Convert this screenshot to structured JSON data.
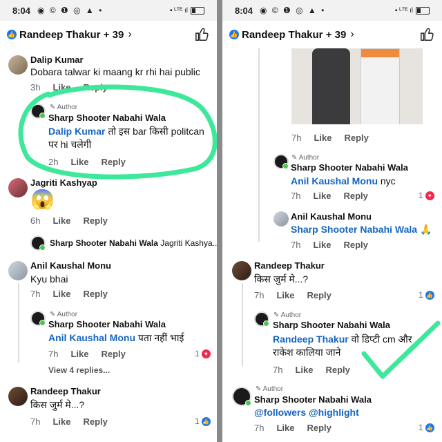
{
  "status": {
    "time": "8:04",
    "icons": "◉ © ❶ ◎ ▲ •",
    "net": "▪ ᴸᵀᴱ ıl"
  },
  "header": {
    "title": "Randeep Thakur + 39",
    "like_glyph": "👍"
  },
  "left": {
    "c1": {
      "name": "Dalip Kumar",
      "text": "Dobara talwar ki maang kr rhi hai public",
      "time": "3h",
      "like": "Like",
      "reply": "Reply"
    },
    "r1": {
      "author_label": "Author",
      "name": "Sharp Shooter Nabahi Wala",
      "mention": "Dalip Kumar",
      "text1": "तो इस bar किसी politcan",
      "text2": "पर hi चलेगी",
      "time": "2h",
      "like": "Like",
      "reply": "Reply"
    },
    "c2": {
      "name": "Jagriti Kashyap",
      "emoji": "😱",
      "time": "6h",
      "like": "Like",
      "reply": "Reply"
    },
    "c2_reply": {
      "name": "Sharp Shooter Nabahi Wala",
      "preview": "Jagriti Kashya..."
    },
    "c3": {
      "name": "Anil Kaushal Monu",
      "text": "Kyu bhai",
      "time": "7h",
      "like": "Like",
      "reply": "Reply"
    },
    "r3": {
      "author_label": "Author",
      "name": "Sharp Shooter Nabahi Wala",
      "mention": "Anil Kaushal Monu",
      "text": "पता नहीं भाई",
      "time": "7h",
      "like": "Like",
      "reply": "Reply",
      "reactions": "1"
    },
    "view_replies": "View 4 replies...",
    "c4": {
      "name": "Randeep Thakur",
      "text": "किस जुर्म मे...?",
      "time": "7h",
      "like": "Like",
      "reply": "Reply",
      "reactions": "1"
    }
  },
  "right": {
    "photo_meta": {
      "time": "7h",
      "like": "Like",
      "reply": "Reply"
    },
    "r1": {
      "author_label": "Author",
      "name": "Sharp Shooter Nabahi Wala",
      "mention": "Anil Kaushal Monu",
      "text": "nyc",
      "time": "7h",
      "like": "Like",
      "reply": "Reply",
      "reactions": "1"
    },
    "r2": {
      "name": "Anil Kaushal Monu",
      "mention": "Sharp Shooter Nabahi Wala",
      "emoji": "🙏",
      "time": "7h",
      "like": "Like",
      "reply": "Reply"
    },
    "c1": {
      "name": "Randeep Thakur",
      "text": "किस जुर्म मे...?",
      "time": "7h",
      "like": "Like",
      "reply": "Reply",
      "reactions": "1"
    },
    "r3": {
      "author_label": "Author",
      "name": "Sharp Shooter Nabahi Wala",
      "mention": "Randeep Thakur",
      "text1": "वो डिप्टी cm और",
      "text2": "राकेश कालिया जाने",
      "time": "7h",
      "like": "Like",
      "reply": "Reply"
    },
    "c2": {
      "author_label": "Author",
      "name": "Sharp Shooter Nabahi Wala",
      "mention": "@followers @highlight",
      "time": "7h",
      "like": "Like",
      "reply": "Reply",
      "reactions": "1"
    }
  },
  "colors": {
    "link": "#1565c0",
    "accent": "#1877f2",
    "annotation": "#3ee89b",
    "love": "#f0284a"
  },
  "icons": {
    "like": "thumbs-up-icon",
    "love": "heart-icon",
    "edit": "pencil-icon",
    "back": "chevron-right-icon"
  }
}
